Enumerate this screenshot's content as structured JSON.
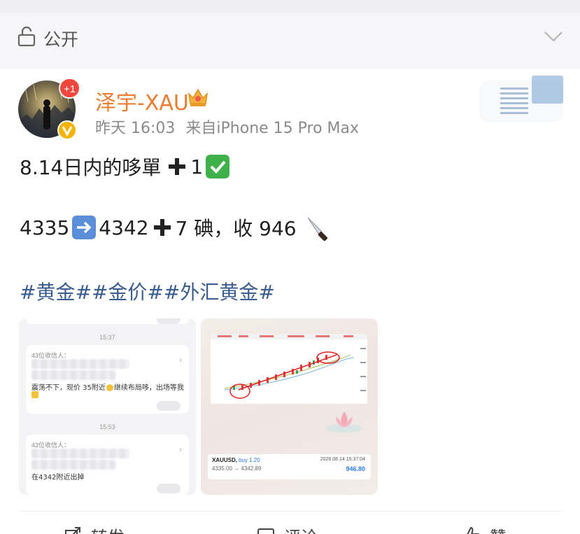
{
  "visibility": {
    "label": "公开",
    "icon": "lock-open-icon"
  },
  "post": {
    "author": {
      "name": "泽宇-XAU",
      "notification_badge": "+1",
      "verified": true
    },
    "timestamp": "昨天 16:03",
    "source": "来自iPhone 15 Pro Max",
    "line1": {
      "text": "8.14日内的哆單",
      "suffix": "1"
    },
    "line2": {
      "from": "4335",
      "to": "4342",
      "gain": "7 碘，收 946"
    },
    "hashtags": [
      "#黄金#",
      "#金价#",
      "#外汇黄金#"
    ]
  },
  "images": {
    "left": {
      "time1": "15:37",
      "recipients1": "43位收信人：",
      "message1": "震荡不下，现价 35附近",
      "message1_tail": "继续布局哆，出场等我",
      "time2": "15:53",
      "recipients2": "43位收信人：",
      "message2": "在4342附近出掉"
    },
    "right": {
      "symbol": "XAUUSD,",
      "lot": "buy 1.20",
      "datetime": "2026.08.14 15:37:04",
      "prices": "4335.00 → 4342.89",
      "profit": "946.80"
    }
  },
  "actions": {
    "repost": "转发",
    "comment": "评论",
    "like": "赞"
  },
  "colors": {
    "username": "#ee7c2e",
    "hashtag": "#3a5c8e",
    "badge": "#f0463b",
    "check_emoji": "#3fb04a",
    "arrow_emoji": "#5a8fd8"
  }
}
